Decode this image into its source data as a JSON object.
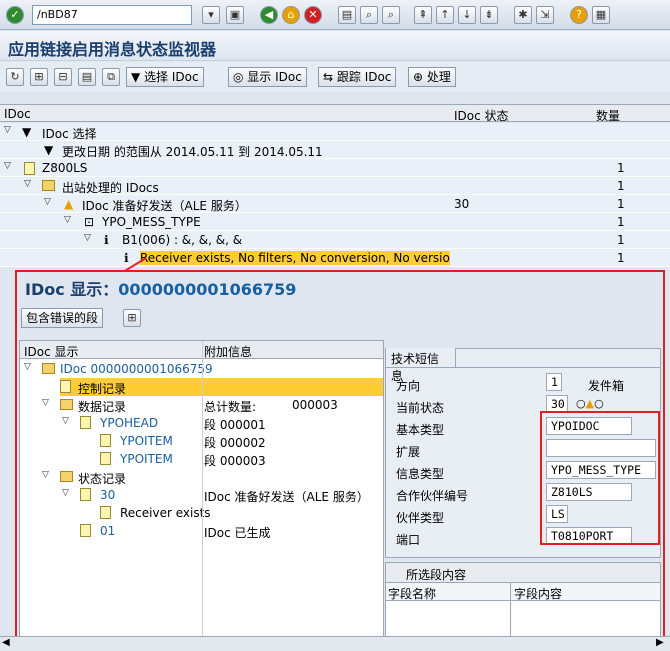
{
  "command_field": "/nBD87",
  "title": "应用链接启用消息状态监视器",
  "app_toolbar": {
    "select_idoc": "选择 IDoc",
    "show_idoc": "显示 IDoc",
    "trace_idoc": "跟踪 IDoc",
    "process": "处理"
  },
  "grid": {
    "columns": [
      "IDoc",
      "IDoc 状态",
      "数量"
    ],
    "rows": [
      {
        "label": "IDoc 选择",
        "status": "",
        "count": ""
      },
      {
        "label": "更改日期 的范围从 2014.05.11 到 2014.05.11",
        "status": "",
        "count": ""
      },
      {
        "label": "Z800LS",
        "status": "",
        "count": "1"
      },
      {
        "label": "出站处理的 IDocs",
        "status": "",
        "count": "1"
      },
      {
        "label": "IDoc 准备好发送（ALE 服务）",
        "status": "30",
        "count": "1"
      },
      {
        "label": "YPO_MESS_TYPE",
        "status": "",
        "count": "1"
      },
      {
        "label": "B1(006) : &, &, &, &",
        "status": "",
        "count": "1"
      },
      {
        "label": "Receiver exists, No filters, No conversion, No version cha",
        "status": "",
        "count": "1"
      }
    ]
  },
  "popup": {
    "title_prefix": "IDoc 显示：",
    "idoc_number": "0000000001066759",
    "error_segments_button": "包含错误的段",
    "tree_headers": [
      "IDoc 显示",
      "附加信息"
    ],
    "tree": [
      {
        "label": "IDoc 0000000001066759",
        "info": ""
      },
      {
        "label": "控制记录",
        "info": ""
      },
      {
        "label": "数据记录",
        "info": "总计数量:",
        "extra": "000003"
      },
      {
        "label": "YPOHEAD",
        "info": "段 000001"
      },
      {
        "label": "YPOITEM",
        "info": "段 000002"
      },
      {
        "label": "YPOITEM",
        "info": "段 000003"
      },
      {
        "label": "状态记录",
        "info": ""
      },
      {
        "label": "30",
        "info": "IDoc 准备好发送（ALE 服务）"
      },
      {
        "label": "Receiver exists",
        "info": ""
      },
      {
        "label": "01",
        "info": "IDoc 已生成"
      }
    ],
    "tech_tab": "技术短信息",
    "fields": {
      "direction_label": "方向",
      "direction_value": "1",
      "direction_text": "发件箱",
      "status_label": "当前状态",
      "status_value": "30",
      "basic_type_label": "基本类型",
      "basic_type_value": "YPOIDOC",
      "extension_label": "扩展",
      "extension_value": "",
      "message_type_label": "信息类型",
      "message_type_value": "YPO_MESS_TYPE",
      "partner_no_label": "合作伙伴编号",
      "partner_no_value": "Z810LS",
      "partner_type_label": "伙伴类型",
      "partner_type_value": "LS",
      "port_label": "端口",
      "port_value": "T0810PORT"
    },
    "segment_section": "所选段内容",
    "segment_headers": [
      "字段名称",
      "字段内容"
    ]
  },
  "colors": {
    "highlight": "#ffcc33",
    "annotation_red": "#e02020",
    "title_blue": "#1a3e6e"
  }
}
